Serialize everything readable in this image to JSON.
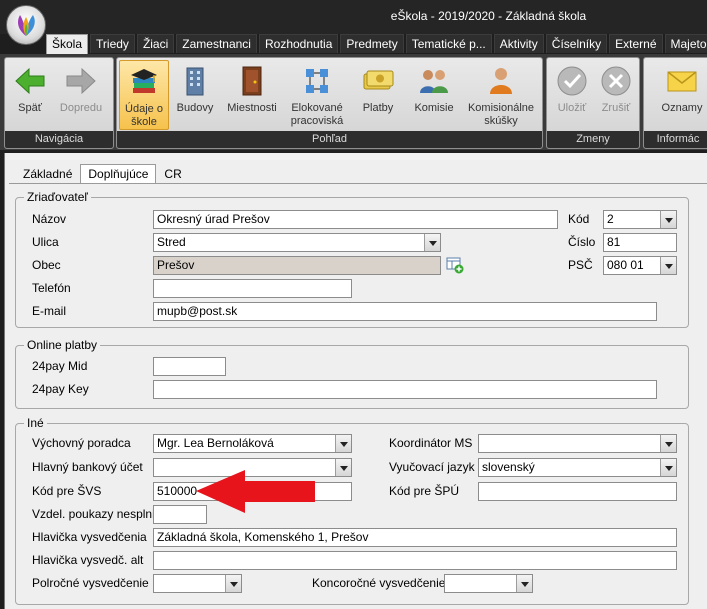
{
  "window": {
    "title": "eŠkola - 2019/2020 - Základná škola"
  },
  "menu_tabs": [
    "Škola",
    "Triedy",
    "Žiaci",
    "Zamestnanci",
    "Rozhodnutia",
    "Predmety",
    "Tematické p...",
    "Aktivity",
    "Číselníky",
    "Externé",
    "Majetok"
  ],
  "ribbon": {
    "navigation": {
      "label": "Navigácia",
      "back": "Späť",
      "forward": "Dopredu"
    },
    "view": {
      "label": "Pohľad",
      "school_info": "Údaje o škole",
      "buildings": "Budovy",
      "rooms": "Miestnosti",
      "detached": "Elokované pracoviská",
      "payments": "Platby",
      "commissions": "Komisie",
      "commission_exams": "Komisionálne skúšky"
    },
    "changes": {
      "label": "Zmeny",
      "save": "Uložiť",
      "cancel": "Zrušiť"
    },
    "info": {
      "label": "Informác",
      "announcements": "Oznamy"
    }
  },
  "subtabs": [
    "Základné",
    "Doplňujúce",
    "CR"
  ],
  "founder": {
    "legend": "Zriaďovateľ",
    "name_label": "Názov",
    "name_value": "Okresný úrad Prešov",
    "street_label": "Ulica",
    "street_value": "Stred",
    "city_label": "Obec",
    "city_value": "Prešov",
    "phone_label": "Telefón",
    "phone_value": "",
    "email_label": "E-mail",
    "email_value": "mupb@post.sk",
    "code_label": "Kód",
    "code_value": "2",
    "number_label": "Číslo",
    "number_value": "81",
    "zip_label": "PSČ",
    "zip_value": "080 01"
  },
  "online": {
    "legend": "Online platby",
    "mid_label": "24pay Mid",
    "mid_value": "",
    "key_label": "24pay Key",
    "key_value": ""
  },
  "other": {
    "legend": "Iné",
    "counselor_label": "Výchovný poradca",
    "counselor_value": "Mgr. Lea Bernoláková",
    "bank_label": "Hlavný bankový účet",
    "bank_value": "",
    "svs_label": "Kód pre ŠVS",
    "svs_value": "510000",
    "voucher_label": "Vzdel. poukazy nesplnili",
    "voucher_value": "",
    "header_label": "Hlavička vysvedčenia",
    "header_value": "Základná škola, Komenského 1, Prešov",
    "header_alt_label": "Hlavička vysvedč. alt",
    "header_alt_value": "",
    "half_label": "Polročné vysvedčenie",
    "half_value": "",
    "ms_label": "Koordinátor MS",
    "ms_value": "",
    "lang_label": "Vyučovací jazyk",
    "lang_value": "slovenský",
    "spu_label": "Kód pre ŠPÚ",
    "spu_value": "",
    "final_label": "Koncoročné vysvedčenie",
    "final_value": ""
  },
  "colors": {
    "arrow": "#e8141b",
    "active_button": "#f6c24c"
  }
}
